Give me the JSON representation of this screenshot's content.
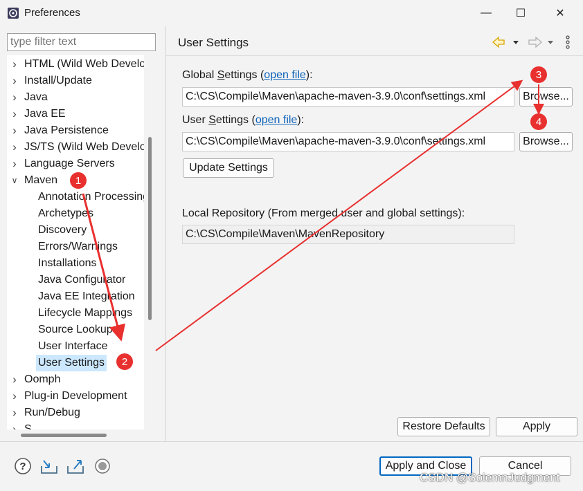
{
  "window": {
    "title": "Preferences",
    "minimize_glyph": "—",
    "maximize_glyph": "☐",
    "close_glyph": "✕"
  },
  "filter": {
    "placeholder": "type filter text"
  },
  "tree": {
    "items": [
      {
        "label": "HTML (Wild Web Developer)",
        "expander": "collapsed"
      },
      {
        "label": "Install/Update",
        "expander": "collapsed"
      },
      {
        "label": "Java",
        "expander": "collapsed"
      },
      {
        "label": "Java EE",
        "expander": "collapsed"
      },
      {
        "label": "Java Persistence",
        "expander": "collapsed"
      },
      {
        "label": "JS/TS (Wild Web Developer)",
        "expander": "collapsed"
      },
      {
        "label": "Language Servers",
        "expander": "collapsed"
      },
      {
        "label": "Maven",
        "expander": "expanded"
      },
      {
        "label": "Annotation Processing",
        "expander": "none"
      },
      {
        "label": "Archetypes",
        "expander": "none"
      },
      {
        "label": "Discovery",
        "expander": "none"
      },
      {
        "label": "Errors/Warnings",
        "expander": "none"
      },
      {
        "label": "Installations",
        "expander": "none"
      },
      {
        "label": "Java Configurator",
        "expander": "none"
      },
      {
        "label": "Java EE Integration",
        "expander": "none"
      },
      {
        "label": "Lifecycle Mappings",
        "expander": "none"
      },
      {
        "label": "Source Lookup",
        "expander": "none"
      },
      {
        "label": "User Interface",
        "expander": "none"
      },
      {
        "label": "User Settings",
        "expander": "none",
        "selected": true
      },
      {
        "label": "Oomph",
        "expander": "collapsed"
      },
      {
        "label": "Plug-in Development",
        "expander": "collapsed"
      },
      {
        "label": "Run/Debug",
        "expander": "collapsed"
      },
      {
        "label": "S",
        "expander": "collapsed"
      }
    ]
  },
  "page": {
    "title": "User Settings",
    "global_label_pre": "Global ",
    "global_label_key": "S",
    "global_label_post": "ettings (",
    "global_link": "open file",
    "global_label_end": "):",
    "global_path": "C:\\CS\\Compile\\Maven\\apache-maven-3.9.0\\conf\\settings.xml",
    "user_label_pre": "User ",
    "user_label_key": "S",
    "user_label_post": "ettings (",
    "user_link": "open file",
    "user_label_end": "):",
    "user_path": "C:\\CS\\Compile\\Maven\\apache-maven-3.9.0\\conf\\settings.xml",
    "browse_label": "Browse...",
    "update_label": "Update Settings",
    "local_repo_label": "Local Repository (From merged user and global settings):",
    "local_repo_path": "C:\\CS\\Compile\\Maven\\MavenRepository",
    "restore_label": "Restore Defaults",
    "apply_label": "Apply"
  },
  "footer": {
    "apply_close_label": "Apply and Close",
    "cancel_label": "Cancel",
    "watermark": "CSDN @SolemnJudgment"
  },
  "annotations": {
    "badges": [
      "1",
      "2",
      "3",
      "4"
    ],
    "color": "#e8302f"
  },
  "colors": {
    "link": "#0b61b8",
    "selection": "#cce8ff",
    "primary_border": "#0067c0"
  }
}
